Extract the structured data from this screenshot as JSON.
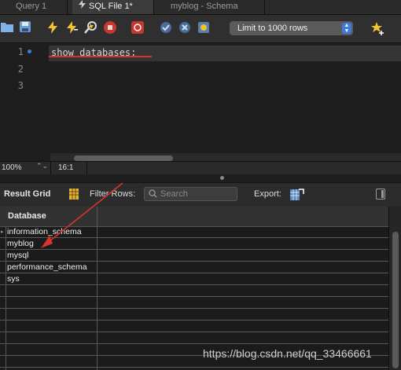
{
  "tabs": [
    {
      "label": "Query 1",
      "active": false
    },
    {
      "label": "SQL File 1*",
      "active": true
    },
    {
      "label": "myblog - Schema",
      "active": false
    }
  ],
  "toolbar": {
    "icons": [
      "folder-icon",
      "save-icon",
      "execute-icon",
      "execute-current-icon",
      "explain-icon",
      "stop-icon",
      "toggle-error-icon",
      "commit-icon",
      "rollback-icon",
      "autocommit-icon",
      "beautify-icon"
    ],
    "limit_select": "Limit to 1000 rows"
  },
  "editor": {
    "line_numbers": [
      "1",
      "2",
      "3"
    ],
    "code": "show databases;"
  },
  "status": {
    "zoom": "100%",
    "position": "16:1"
  },
  "result_toolbar": {
    "result_grid_label": "Result Grid",
    "filter_label": "Filter Rows:",
    "search_placeholder": "Search",
    "export_label": "Export:"
  },
  "grid": {
    "columns": [
      "Database"
    ],
    "rows": [
      "information_schema",
      "myblog",
      "mysql",
      "performance_schema",
      "sys"
    ]
  },
  "watermark": "https://blog.csdn.net/qq_33466661",
  "colors": {
    "annotation": "#d9342b",
    "accent": "#3d7ce0"
  }
}
